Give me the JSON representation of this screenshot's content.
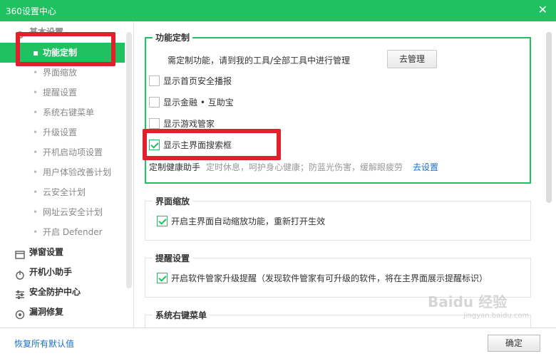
{
  "window": {
    "title": "360设置中心",
    "close_glyph": "✕"
  },
  "sidebar": {
    "basic_header": "基本设置",
    "active_item": "功能定制",
    "sub_items": [
      "界面缩放",
      "提醒设置",
      "系统右键菜单",
      "升级设置",
      "开机启动项设置",
      "用户体验改善计划",
      "云安全计划",
      "网址云安全计划",
      "开启 Defender"
    ],
    "groups": [
      {
        "label": "弹窗设置",
        "icon": "window-icon"
      },
      {
        "label": "开机小助手",
        "icon": "power-icon"
      },
      {
        "label": "安全防护中心",
        "icon": "sliders-icon"
      },
      {
        "label": "漏洞修复",
        "icon": "target-icon"
      }
    ]
  },
  "main": {
    "custom_section": {
      "title": "功能定制",
      "desc": "需定制功能，请到我的工具/全部工具中进行管理",
      "manage_button": "去管理",
      "options": [
        {
          "label": "显示首页安全播报",
          "checked": false
        },
        {
          "label": "显示金融 • 互助宝",
          "checked": false
        },
        {
          "label": "显示游戏管家",
          "checked": false
        },
        {
          "label": "显示主界面搜索框",
          "checked": true
        }
      ],
      "health_label": "定制健康助手",
      "health_desc": "定时休息，呵护身心健康；防蓝光伤害，缓解眼疲劳",
      "health_link": "去设置"
    },
    "zoom_section": {
      "title": "界面缩放",
      "option": "开启主界面自动缩放功能，重新打开生效",
      "checked": true
    },
    "remind_section": {
      "title": "提醒设置",
      "option": "开启软件管家升级提醒（发现软件管家有可升级的软件，将在主界面展示提醒标识）",
      "checked": true
    },
    "context_section": {
      "title": "系统右键菜单"
    }
  },
  "footer": {
    "restore_link": "恢复所有默认值",
    "ok_button": "确定"
  },
  "watermark": {
    "text": "Baidu 经验",
    "sub": "jingyan.baidu.com"
  },
  "colors": {
    "accent": "#1fc161",
    "highlight": "#e0202a",
    "link": "#1a6fd1"
  }
}
